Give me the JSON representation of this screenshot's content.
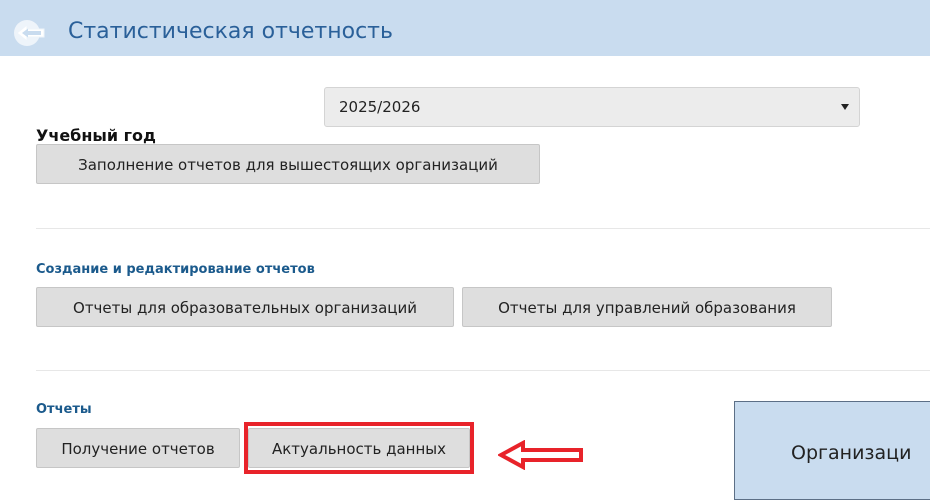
{
  "header": {
    "title": "Статистическая отчетность",
    "back_icon": "back-arrow-icon"
  },
  "year": {
    "label": "Учебный год",
    "value": "2025/2026"
  },
  "top_button": {
    "label": "Заполнение отчетов для вышестоящих организаций"
  },
  "sections": {
    "create": {
      "heading": "Создание и редактирование отчетов",
      "buttons": [
        "Отчеты для образовательных организаций",
        "Отчеты для управлений образования"
      ]
    },
    "reports": {
      "heading": "Отчеты",
      "buttons": [
        "Получение отчетов",
        "Актуальность данных"
      ]
    }
  },
  "side_panel": {
    "label": "Организаци"
  },
  "colors": {
    "header_bg": "#c9dcef",
    "title": "#2a6099",
    "heading": "#1b5a8c",
    "highlight": "#e8232a"
  }
}
